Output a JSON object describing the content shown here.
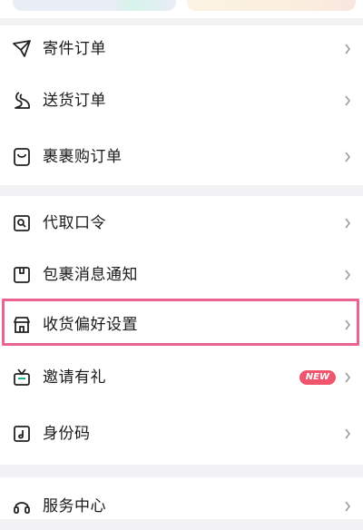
{
  "menu": {
    "orders": [
      {
        "label": "寄件订单",
        "icon": "send-plane-icon"
      },
      {
        "label": "送货订单",
        "icon": "delivery-icon"
      },
      {
        "label": "裹裹购订单",
        "icon": "shopping-bag-icon"
      }
    ],
    "services": [
      {
        "label": "代取口令",
        "icon": "pickup-code-icon"
      },
      {
        "label": "包裹消息通知",
        "icon": "package-notify-icon"
      },
      {
        "label": "收货偏好设置",
        "icon": "store-icon"
      },
      {
        "label": "邀请有礼",
        "icon": "gift-tv-icon",
        "badge": "NEW"
      },
      {
        "label": "身份码",
        "icon": "id-code-icon"
      }
    ],
    "support": [
      {
        "label": "服务中心",
        "icon": "headset-icon"
      }
    ]
  },
  "colors": {
    "highlight": "#e9648f",
    "badge": "#f0556e"
  }
}
